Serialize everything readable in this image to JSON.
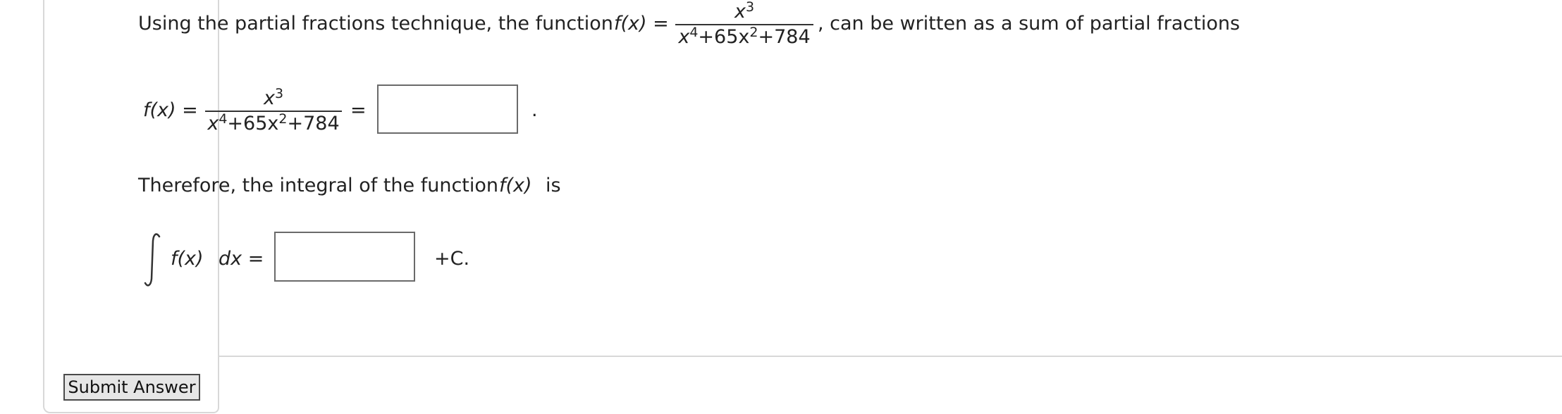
{
  "problem": {
    "intro_text": "Using the partial fractions technique, the function",
    "func_label": "f(x) =",
    "numerator_base": "x",
    "numerator_exp": "3",
    "denominator_x": "x",
    "denominator_exp1": "4",
    "denominator_mid": "+65x",
    "denominator_exp2": "2",
    "denominator_end": "+784",
    "intro_suffix": ", can be written as a sum of partial fractions",
    "equation_label": "f(x) =",
    "equals_sign": "=",
    "period": ".",
    "therefore_text": "Therefore, the integral of the function",
    "therefore_func": "f(x)",
    "therefore_suffix": "is",
    "integrand": "f(x)",
    "dx_label": "dx =",
    "constant": "+C."
  },
  "inputs": {
    "partial_fraction_value": "",
    "integral_value": ""
  },
  "actions": {
    "submit_label": "Submit Answer"
  }
}
